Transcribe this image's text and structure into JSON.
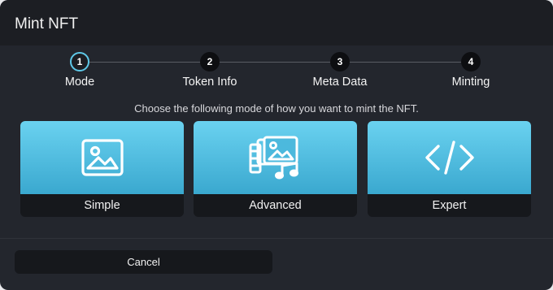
{
  "modal": {
    "title": "Mint NFT"
  },
  "stepper": {
    "steps": [
      {
        "number": "1",
        "label": "Mode",
        "active": true
      },
      {
        "number": "2",
        "label": "Token Info",
        "active": false
      },
      {
        "number": "3",
        "label": "Meta Data",
        "active": false
      },
      {
        "number": "4",
        "label": "Minting",
        "active": false
      }
    ]
  },
  "instruction": "Choose the following mode of how you want to mint the NFT.",
  "modes": [
    {
      "label": "Simple",
      "icon": "image-icon"
    },
    {
      "label": "Advanced",
      "icon": "media-collection-icon"
    },
    {
      "label": "Expert",
      "icon": "code-icon"
    }
  ],
  "footer": {
    "cancel_label": "Cancel"
  },
  "colors": {
    "accent": "#5ec8e8",
    "card_gradient_top": "#6ad2f0",
    "card_gradient_bottom": "#3aa8cf",
    "background": "#23262d"
  }
}
